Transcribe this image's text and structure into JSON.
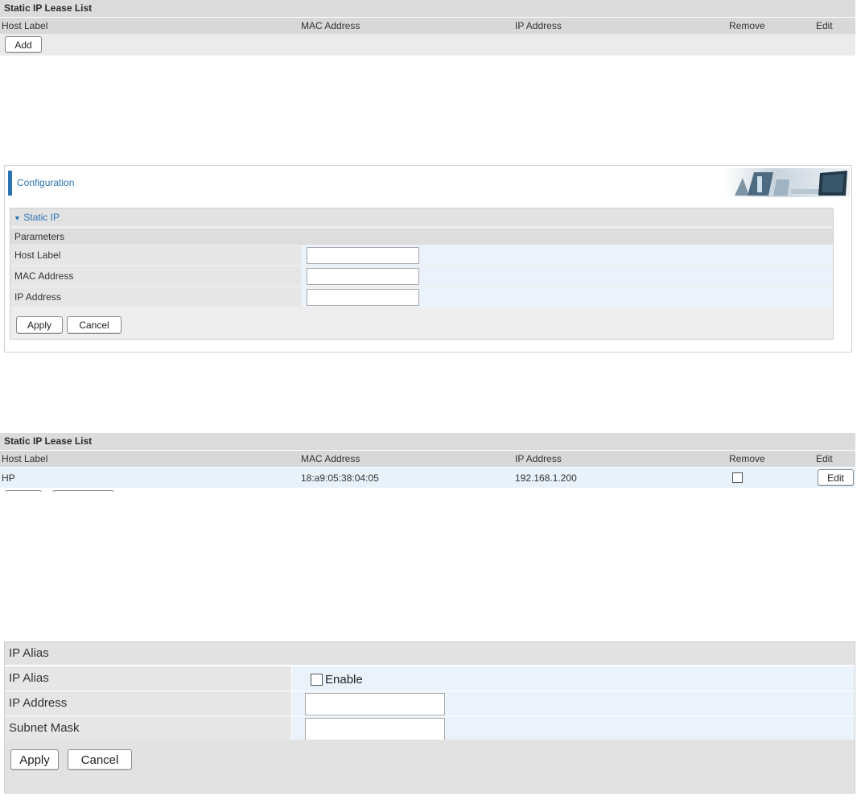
{
  "lease_list_empty": {
    "title": "Static IP Lease List",
    "columns": [
      "Host Label",
      "MAC Address",
      "IP Address",
      "Remove",
      "Edit"
    ],
    "add_button": "Add"
  },
  "configuration": {
    "title": "Configuration",
    "section_label": "Static IP",
    "parameters_label": "Parameters",
    "fields": [
      {
        "label": "Host Label",
        "value": ""
      },
      {
        "label": "MAC Address",
        "value": ""
      },
      {
        "label": "IP Address",
        "value": ""
      }
    ],
    "apply_button": "Apply",
    "cancel_button": "Cancel"
  },
  "lease_list_filled": {
    "title": "Static IP Lease List",
    "columns": [
      "Host Label",
      "MAC Address",
      "IP Address",
      "Remove",
      "Edit"
    ],
    "rows": [
      {
        "host_label": "HP",
        "mac": "18:a9:05:38:04:05",
        "ip": "192.168.1.200",
        "remove_checked": false,
        "edit_label": "Edit"
      }
    ]
  },
  "ip_alias": {
    "title": "IP Alias",
    "fields": [
      {
        "label": "IP Alias",
        "checkbox_label": "Enable",
        "checked": false
      },
      {
        "label": "IP Address",
        "value": ""
      },
      {
        "label": "Subnet Mask",
        "value": ""
      }
    ],
    "apply_button": "Apply",
    "cancel_button": "Cancel"
  },
  "colors": {
    "accent": "#2b73b3",
    "header_gray": "#dcdcdc",
    "field_blue": "#eaf3fb"
  }
}
